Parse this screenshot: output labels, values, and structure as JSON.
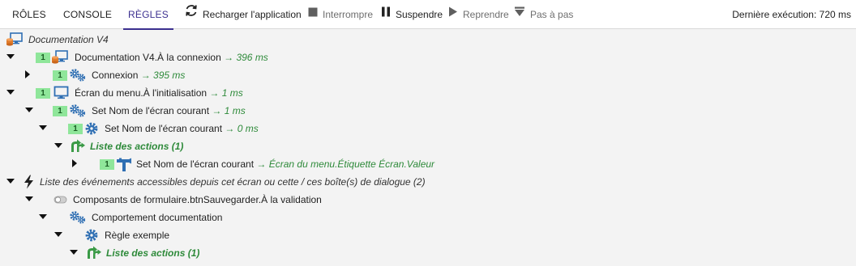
{
  "toolbar": {
    "tabs": [
      {
        "label": "RÔLES"
      },
      {
        "label": "CONSOLE"
      },
      {
        "label": "RÈGLES",
        "active": true
      }
    ],
    "buttons": {
      "reload": {
        "label": "Recharger l'application",
        "icon": "reload-icon"
      },
      "interrupt": {
        "label": "Interrompre",
        "icon": "stop-icon"
      },
      "suspend": {
        "label": "Suspendre",
        "icon": "pause-icon"
      },
      "resume": {
        "label": "Reprendre",
        "icon": "play-icon"
      },
      "step": {
        "label": "Pas à pas",
        "icon": "step-icon"
      }
    },
    "last_exec": "Dernière exécution: 720 ms"
  },
  "colors": {
    "accent": "#3b2f8f",
    "badge_bg": "#8fe69a",
    "green_text": "#2e8a3a",
    "icon_blue": "#2f6fb3"
  },
  "tree": {
    "root": {
      "label": "Documentation V4"
    },
    "n1": {
      "count": "1",
      "label": "Documentation V4.À la connexion",
      "time": "→ 396 ms"
    },
    "n2": {
      "count": "1",
      "label": "Connexion",
      "time": "→ 395 ms"
    },
    "n3": {
      "count": "1",
      "label": "Écran du menu.À l'initialisation",
      "time": "→ 1 ms"
    },
    "n4": {
      "count": "1",
      "label": "Set Nom de l'écran courant",
      "time": "→ 1 ms"
    },
    "n5": {
      "count": "1",
      "label": "Set Nom de l'écran courant",
      "time": "→ 0 ms"
    },
    "n6": {
      "label": "Liste des actions (1)"
    },
    "n7": {
      "count": "1",
      "label": "Set Nom de l'écran courant",
      "time": "→ Écran du menu.Étiquette Écran.Valeur"
    },
    "n8": {
      "label": "Liste des événements accessibles depuis cet écran ou cette / ces boîte(s) de dialogue (2)"
    },
    "n9": {
      "label": "Composants de formulaire.btnSauvegarder.À la validation"
    },
    "n10": {
      "label": "Comportement documentation"
    },
    "n11": {
      "label": "Règle exemple"
    },
    "n12": {
      "label": "Liste des actions (1)"
    }
  }
}
